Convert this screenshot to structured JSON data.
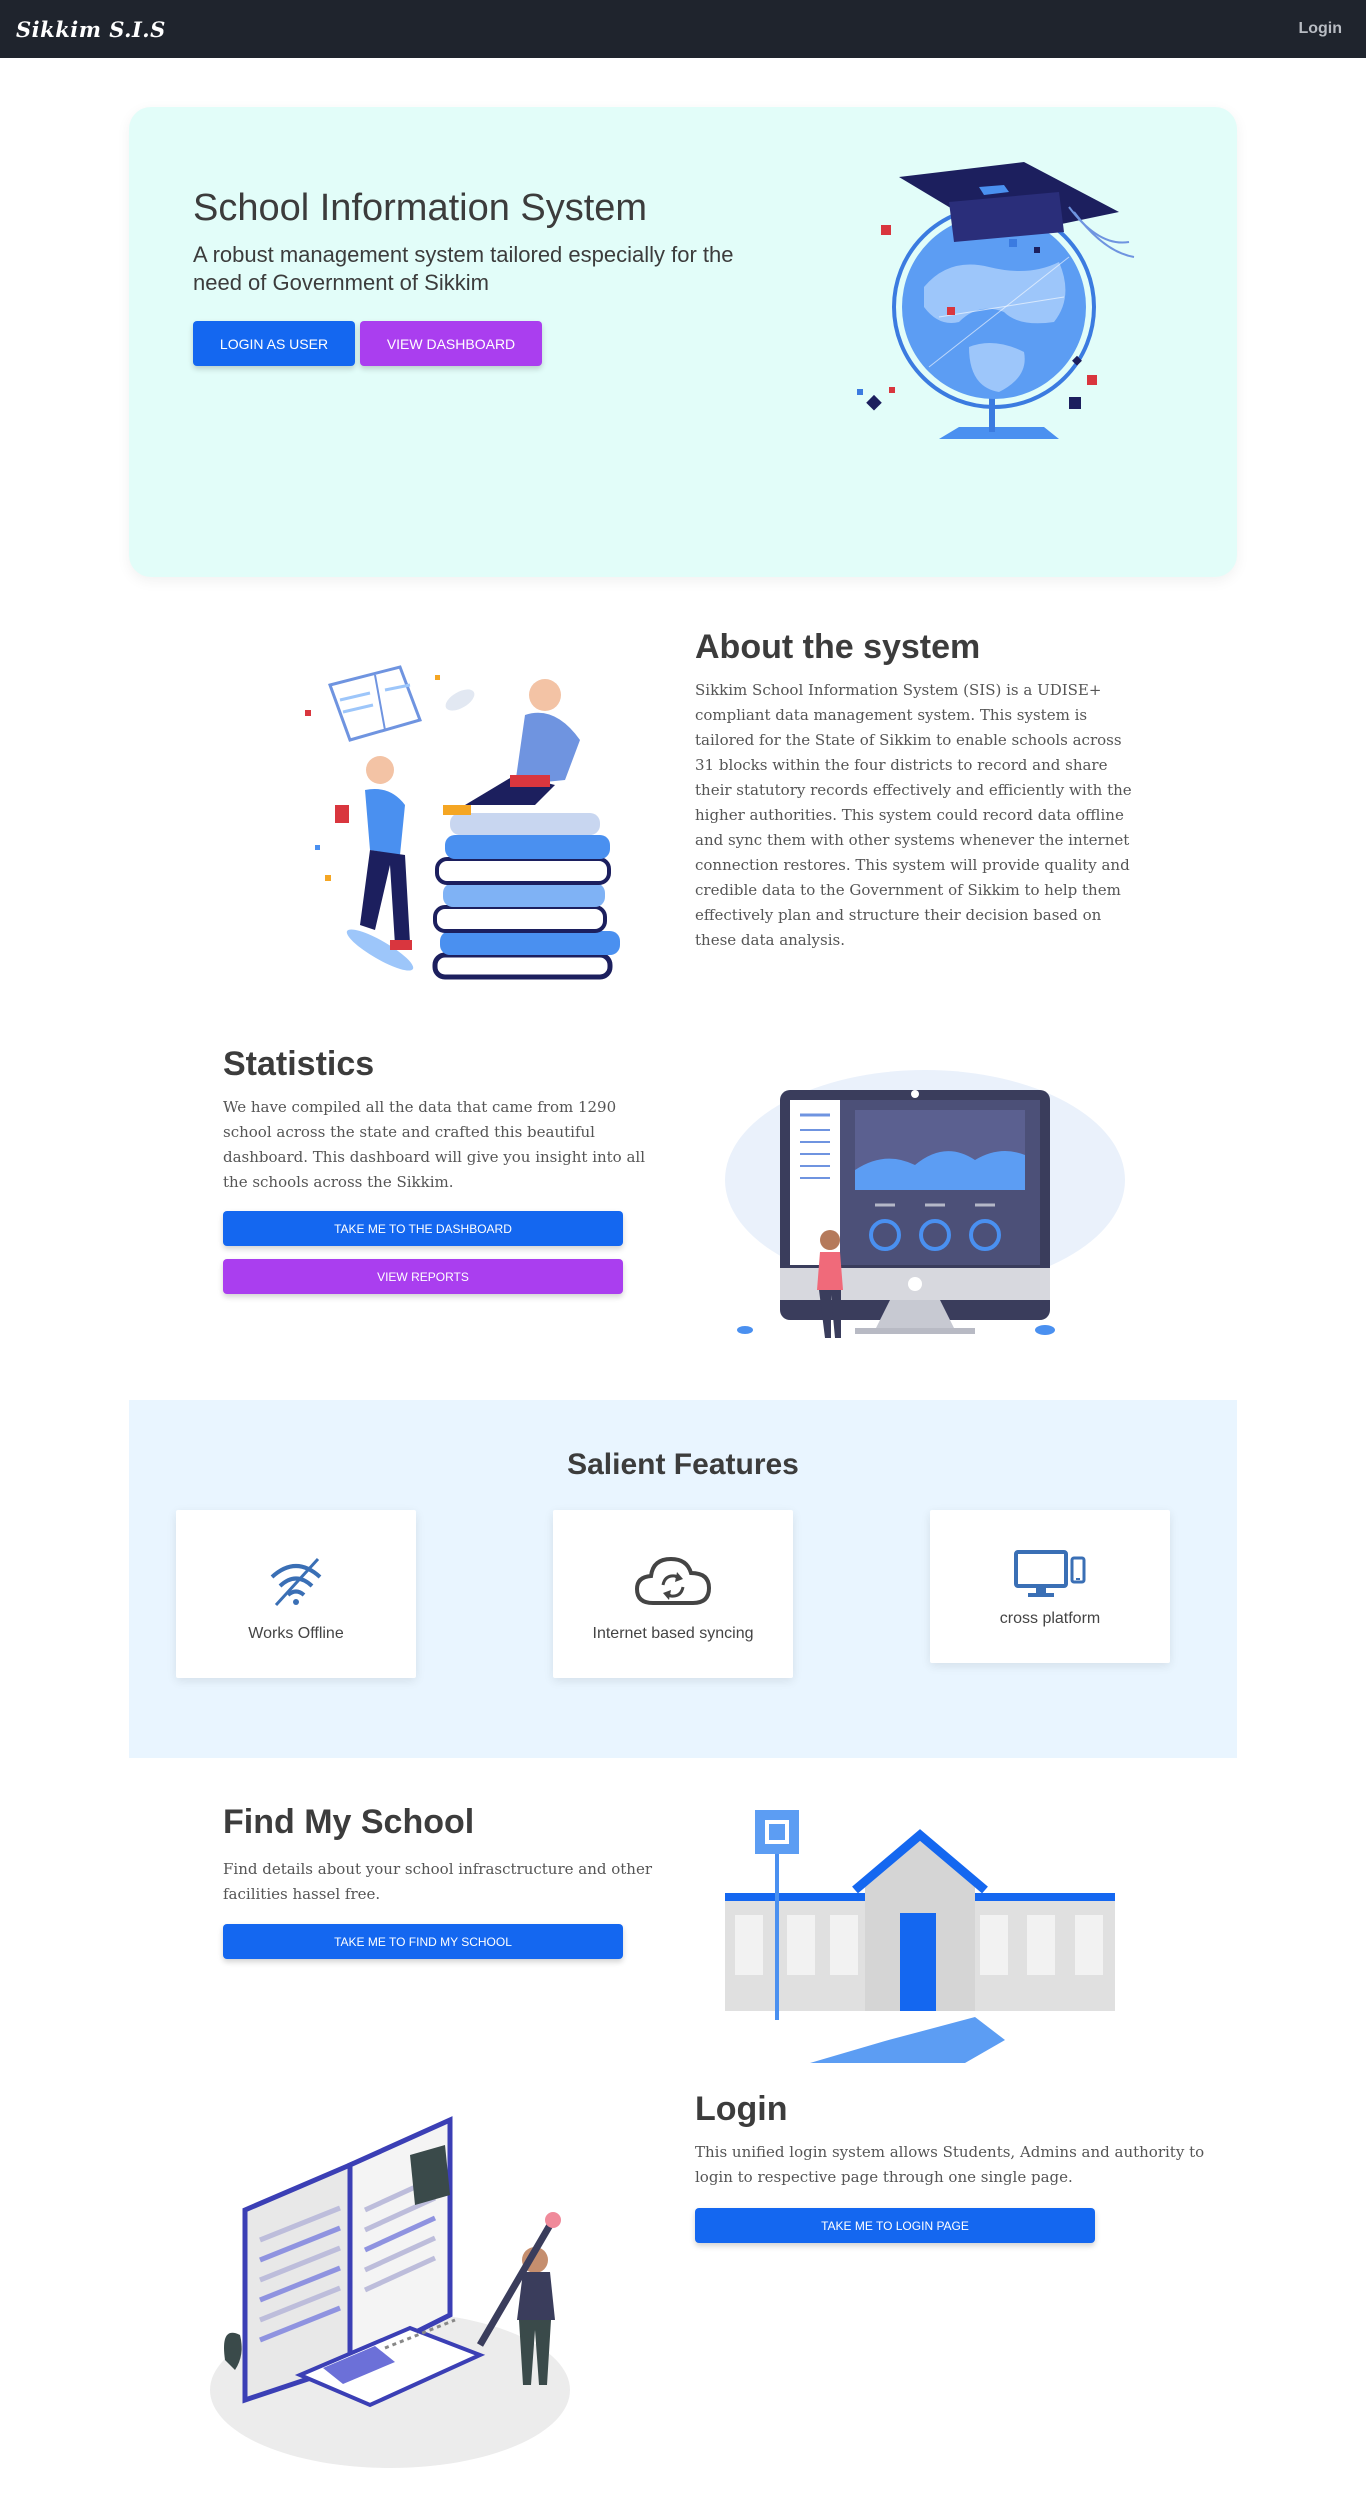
{
  "nav": {
    "brand": "Sikkim S.I.S",
    "login": "Login"
  },
  "hero": {
    "title": "School Information System",
    "subtitle": "A robust management system tailored especially for the need of Government of Sikkim",
    "login_button": "LOGIN AS USER",
    "dashboard_button": "VIEW DASHBOARD"
  },
  "about": {
    "title": "About the system",
    "text": "Sikkim School Information System (SIS) is a UDISE+ compliant data management system. This system is tailored for the State of Sikkim to enable schools across 31 blocks within the four districts to record and share their statutory records effectively and efficiently with the higher authorities. This system could record data offline and sync them with other systems whenever the internet connection restores. This system will provide quality and credible data to the Government of Sikkim to help them effectively plan and structure their decision based on these data analysis."
  },
  "statistics": {
    "title": "Statistics",
    "text": "We have compiled all the data that came from 1290 school across the state and crafted this beautiful dashboard. This dashboard will give you insight into all the schools across the Sikkim.",
    "dashboard_button": "TAKE ME TO THE DASHBOARD",
    "reports_button": "VIEW REPORTS"
  },
  "features": {
    "title": "Salient Features",
    "items": [
      {
        "label": "Works Offline",
        "icon": "wifi-off-icon"
      },
      {
        "label": "Internet based syncing",
        "icon": "cloud-sync-icon"
      },
      {
        "label": "cross platform",
        "icon": "devices-icon"
      }
    ]
  },
  "find_school": {
    "title": "Find My School",
    "text": "Find details about your school infrasctructure and other facilities hassel free.",
    "button": "TAKE ME TO FIND MY SCHOOL"
  },
  "login": {
    "title": "Login",
    "text": "This unified login system allows Students, Admins and authority to login to respective page through one single page.",
    "button": "TAKE ME TO LOGIN PAGE"
  },
  "colors": {
    "navbar": "#1f242d",
    "hero_bg": "#e2fdf9",
    "features_bg": "#e9f5ff",
    "primary": "#1467f0",
    "secondary": "#aa3eef"
  }
}
